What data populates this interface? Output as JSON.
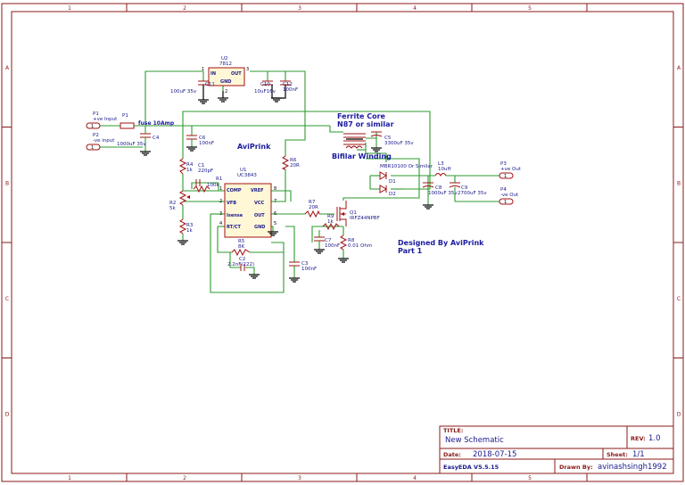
{
  "sheet": {
    "col_labels": [
      "1",
      "2",
      "3",
      "4",
      "5"
    ],
    "row_labels": [
      "A",
      "B",
      "C",
      "D"
    ]
  },
  "notes": {
    "aviprink": "AviPrink",
    "ferrite_1": "Ferrite Core",
    "ferrite_2": "N87 or similar",
    "bifilar": "Bifilar Winding",
    "designed_1": "Designed By AviPrink",
    "designed_2": "Part 1"
  },
  "components": {
    "u2_ref": "U2",
    "u2_val": "7812",
    "u2_in": "IN",
    "u2_out": "OUT",
    "u2_gnd": "GND",
    "u2_pin1": "1",
    "u2_pin2": "2",
    "u2_pin3": "3",
    "c11": "C11",
    "c11_val": "100uF 35v",
    "c10": "C10",
    "c10_val": "10uF16v",
    "c12": "C12",
    "c12_val": "100nF",
    "p1in_ref": "P1",
    "p1in_val": "+ve Input",
    "p2in_ref": "P2",
    "p2in_val": "-ve input",
    "fuse_ref": "P1",
    "fuse_val": "fuse 10Amp",
    "c4": "C4",
    "c4_val": "1000uF 35v",
    "c6": "C6",
    "c6_val": "100nF",
    "c5": "C5",
    "c5_val": "3300uF 35v",
    "r4": "R4",
    "r4_val": "1k",
    "c1": "C1",
    "c1_val": "220pF",
    "r1": "R1",
    "r1_val": "100k",
    "r2": "R2",
    "r2_val": "5k",
    "r3": "R3",
    "r3_val": "1k",
    "r6": "R6",
    "r6_val": "20R",
    "u1_ref": "U1",
    "u1_val": "UC3843",
    "u1_p1": "COMP",
    "u1_p2": "VFB",
    "u1_p3": "Isense",
    "u1_p4": "RT/CT",
    "u1_p8": "VREF",
    "u1_p7": "VCC",
    "u1_p6": "OUT",
    "u1_p5": "GND",
    "u1_n1": "1",
    "u1_n2": "2",
    "u1_n3": "3",
    "u1_n4": "4",
    "u1_n5": "5",
    "u1_n6": "6",
    "u1_n7": "7",
    "u1_n8": "8",
    "r5": "R5",
    "r5_val": "8K",
    "c2": "C2",
    "c2_val": "2.2nF(222)",
    "c3": "C3",
    "c3_val": "100nF",
    "r7": "R7",
    "r7_val": "20R",
    "r9": "R9",
    "r9_val": "1k",
    "q1": "Q1",
    "q1_val": "IRFZ44NPBF",
    "c7": "C7",
    "c7_val": "100nF",
    "r8": "R8",
    "r8_val": "0.01 Ohm",
    "d_val": "MBR10100 Or Similar",
    "d1": "D1",
    "d2": "D2",
    "l3": "L3",
    "l3_val": "10uH",
    "c8": "C8",
    "c8_val": "1000uF 35v",
    "c9": "C9",
    "c9_val": "2700uF 35v",
    "p3_ref": "P3",
    "p3_val": "+ve Out",
    "p4_ref": "P4",
    "p4_val": "-ve Out",
    "pin1": "1",
    "pin2": "2"
  },
  "title_block": {
    "title_label": "TITLE:",
    "title": "New Schematic",
    "rev_label": "REV:",
    "rev": "1.0",
    "date_label": "Date:",
    "date": "2018-07-15",
    "sheet_label": "Sheet:",
    "sheet": "1/1",
    "tool": "EasyEDA V5.5.15",
    "drawn_label": "Drawn By:",
    "drawn": "avinashsingh1992"
  }
}
